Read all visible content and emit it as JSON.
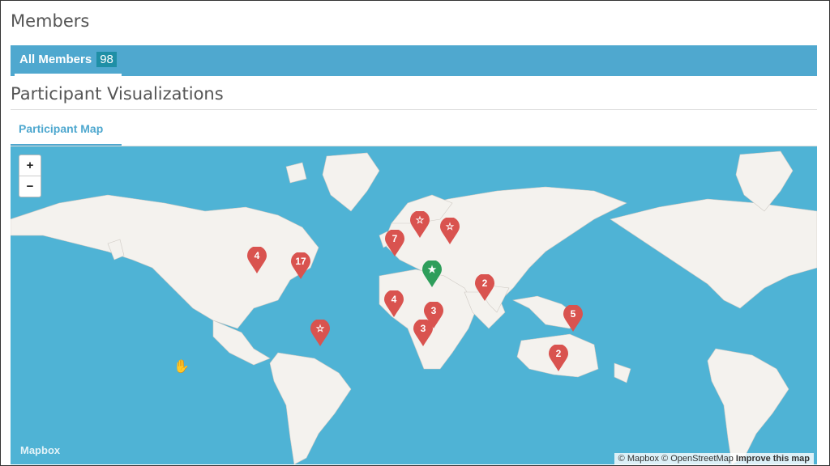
{
  "header": {
    "title": "Members"
  },
  "tabs": {
    "all_members_label": "All Members",
    "all_members_count": "98"
  },
  "visualizations": {
    "title": "Participant Visualizations",
    "map_tab": "Participant Map"
  },
  "map": {
    "zoom_in": "+",
    "zoom_out": "−",
    "logo": "Mapbox",
    "attribution_mapbox": "© Mapbox",
    "attribution_osm": "© OpenStreetMap",
    "attribution_improve": "Improve this map",
    "colors": {
      "water": "#4fb3d5",
      "land": "#f4f2ee",
      "marker_red": "#d9534f",
      "marker_green": "#2e9e5b"
    },
    "markers": [
      {
        "label": "4",
        "icon": "cluster"
      },
      {
        "label": "17",
        "icon": "cluster"
      },
      {
        "label": "7",
        "icon": "cluster"
      },
      {
        "label": "",
        "icon": "star-outline-icon"
      },
      {
        "label": "",
        "icon": "star-outline-icon"
      },
      {
        "label": "",
        "icon": "star-icon"
      },
      {
        "label": "2",
        "icon": "cluster"
      },
      {
        "label": "4",
        "icon": "cluster"
      },
      {
        "label": "3",
        "icon": "cluster"
      },
      {
        "label": "3",
        "icon": "cluster"
      },
      {
        "label": "",
        "icon": "star-outline-icon"
      },
      {
        "label": "5",
        "icon": "cluster"
      },
      {
        "label": "2",
        "icon": "cluster"
      }
    ]
  }
}
